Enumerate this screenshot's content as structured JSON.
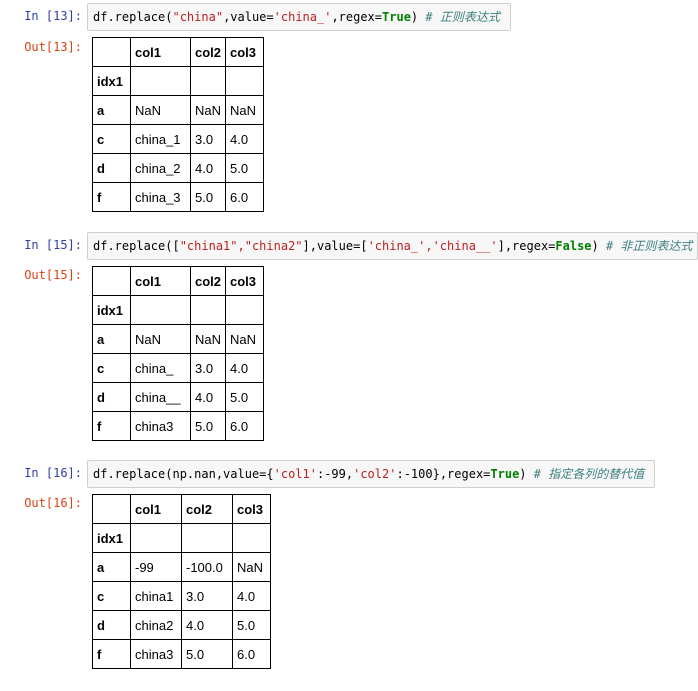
{
  "cells": [
    {
      "in_prompt": "In  [13]:",
      "out_prompt": "Out[13]:",
      "code": {
        "prefix": "df.replace(",
        "arg1": "\"china\"",
        "mid1": ",value=",
        "arg2": "'china_'",
        "mid2": ",regex=",
        "kw": "True",
        "close": ") ",
        "comment": "# 正则表达式"
      },
      "table": {
        "columns": [
          "col1",
          "col2",
          "col3"
        ],
        "index_name": "idx1",
        "rows": [
          {
            "idx": "a",
            "vals": [
              "NaN",
              "NaN",
              "NaN"
            ]
          },
          {
            "idx": "c",
            "vals": [
              "china_1",
              "3.0",
              "4.0"
            ]
          },
          {
            "idx": "d",
            "vals": [
              "china_2",
              "4.0",
              "5.0"
            ]
          },
          {
            "idx": "f",
            "vals": [
              "china_3",
              "5.0",
              "6.0"
            ]
          }
        ]
      }
    },
    {
      "in_prompt": "In  [15]:",
      "out_prompt": "Out[15]:",
      "code": {
        "prefix": "df.replace([",
        "arg1": "\"china1\",\"china2\"",
        "mid1": "],value=[",
        "arg2": "'china_','china__'",
        "mid2": "],regex=",
        "kw": "False",
        "close": ") ",
        "comment": "# 非正则表达式"
      },
      "table": {
        "columns": [
          "col1",
          "col2",
          "col3"
        ],
        "index_name": "idx1",
        "rows": [
          {
            "idx": "a",
            "vals": [
              "NaN",
              "NaN",
              "NaN"
            ]
          },
          {
            "idx": "c",
            "vals": [
              "china_",
              "3.0",
              "4.0"
            ]
          },
          {
            "idx": "d",
            "vals": [
              "china__",
              "4.0",
              "5.0"
            ]
          },
          {
            "idx": "f",
            "vals": [
              "china3",
              "5.0",
              "6.0"
            ]
          }
        ]
      }
    },
    {
      "in_prompt": "In  [16]:",
      "out_prompt": "Out[16]:",
      "code": {
        "prefix": "df.replace(np.nan,value={",
        "arg1": "'col1'",
        "mid1": ":-99,",
        "arg2": "'col2'",
        "mid2": ":-100},regex=",
        "kw": "True",
        "close": ") ",
        "comment": "# 指定各列的替代值"
      },
      "table": {
        "columns": [
          "col1",
          "col2",
          "col3"
        ],
        "index_name": "idx1",
        "rows": [
          {
            "idx": "a",
            "vals": [
              "-99",
              "-100.0",
              "NaN"
            ]
          },
          {
            "idx": "c",
            "vals": [
              "china1",
              "3.0",
              "4.0"
            ]
          },
          {
            "idx": "d",
            "vals": [
              "china2",
              "4.0",
              "5.0"
            ]
          },
          {
            "idx": "f",
            "vals": [
              "china3",
              "5.0",
              "6.0"
            ]
          }
        ]
      }
    }
  ]
}
